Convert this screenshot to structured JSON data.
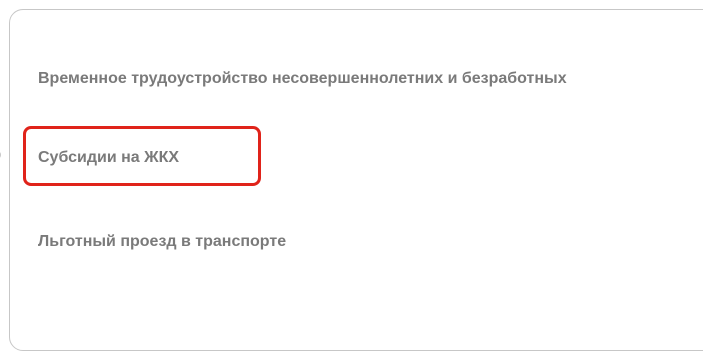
{
  "menu": {
    "items": [
      {
        "label": "Временное трудоустройство несовершеннолетних и безработных"
      },
      {
        "label": "Субсидии на ЖКХ",
        "highlighted": true
      },
      {
        "label": "Льготный проезд в транспорте"
      }
    ]
  },
  "edge_glyph": ")",
  "colors": {
    "text": "#7a7a7a",
    "highlight_border": "#e0231a",
    "card_border": "#c7c7c7"
  }
}
